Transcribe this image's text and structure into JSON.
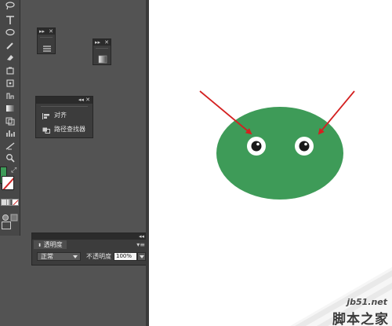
{
  "panels": {
    "dock": {
      "items": [
        {
          "label": "对齐",
          "icon": "align-icon"
        },
        {
          "label": "路径查找器",
          "icon": "pathfinder-icon"
        }
      ]
    },
    "transparency": {
      "tab_label": "透明度",
      "blend_mode": "正常",
      "opacity_label": "不透明度",
      "opacity_value": "100%"
    }
  },
  "artwork": {
    "shape": "green-ellipse",
    "fill_color": "#3e9b58",
    "arrow_color": "#d42020",
    "eye_count": 2
  },
  "toolbar": {
    "fill_color": "#3e9b58",
    "stroke_color": "none"
  },
  "watermark": {
    "site": "jb51.net",
    "brand": "脚本之家"
  }
}
